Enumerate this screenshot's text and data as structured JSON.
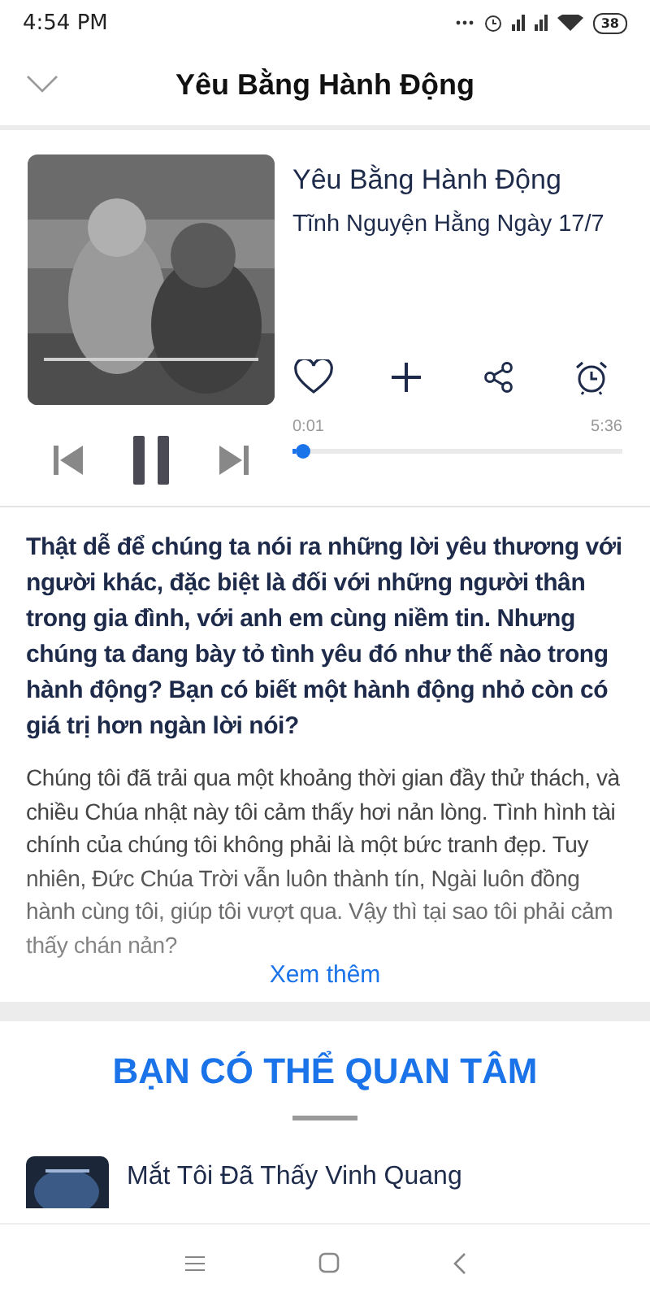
{
  "status_bar": {
    "time": "4:54 PM",
    "battery": "38"
  },
  "header": {
    "title": "Yêu Bằng Hành Động"
  },
  "player": {
    "title": "Yêu Bằng Hành Động",
    "subtitle": "Tĩnh Nguyện Hằng Ngày 17/7",
    "liked": false,
    "playing": true,
    "elapsed": "0:01",
    "duration": "5:36",
    "level": 0.01
  },
  "description": {
    "lead": "Thật dễ để chúng ta nói ra những lời yêu thương với người khác, đặc biệt là đối với những người thân trong gia đình, với anh em cùng niềm tin. Nhưng chúng ta đang bày tỏ tình yêu đó như thế nào trong hành động? Bạn có biết một hành động nhỏ còn có giá trị hơn ngàn lời nói?",
    "body": "Chúng tôi đã trải qua một khoảng thời gian đầy thử thách, và chiều Chúa nhật này tôi cảm thấy hơi nản lòng. Tình hình tài chính của chúng tôi không phải là một bức tranh đẹp. Tuy nhiên, Đức Chúa Trời vẫn luôn thành tín, Ngài luôn đồng hành cùng tôi, giúp tôi vượt qua. Vậy thì tại sao tôi phải cảm thấy chán nản?",
    "more": "Xem thêm"
  },
  "suggestions": {
    "heading": "BẠN CÓ THỂ QUAN TÂM",
    "items": [
      {
        "title": "Mắt Tôi Đã Thấy Vinh Quang"
      }
    ]
  }
}
